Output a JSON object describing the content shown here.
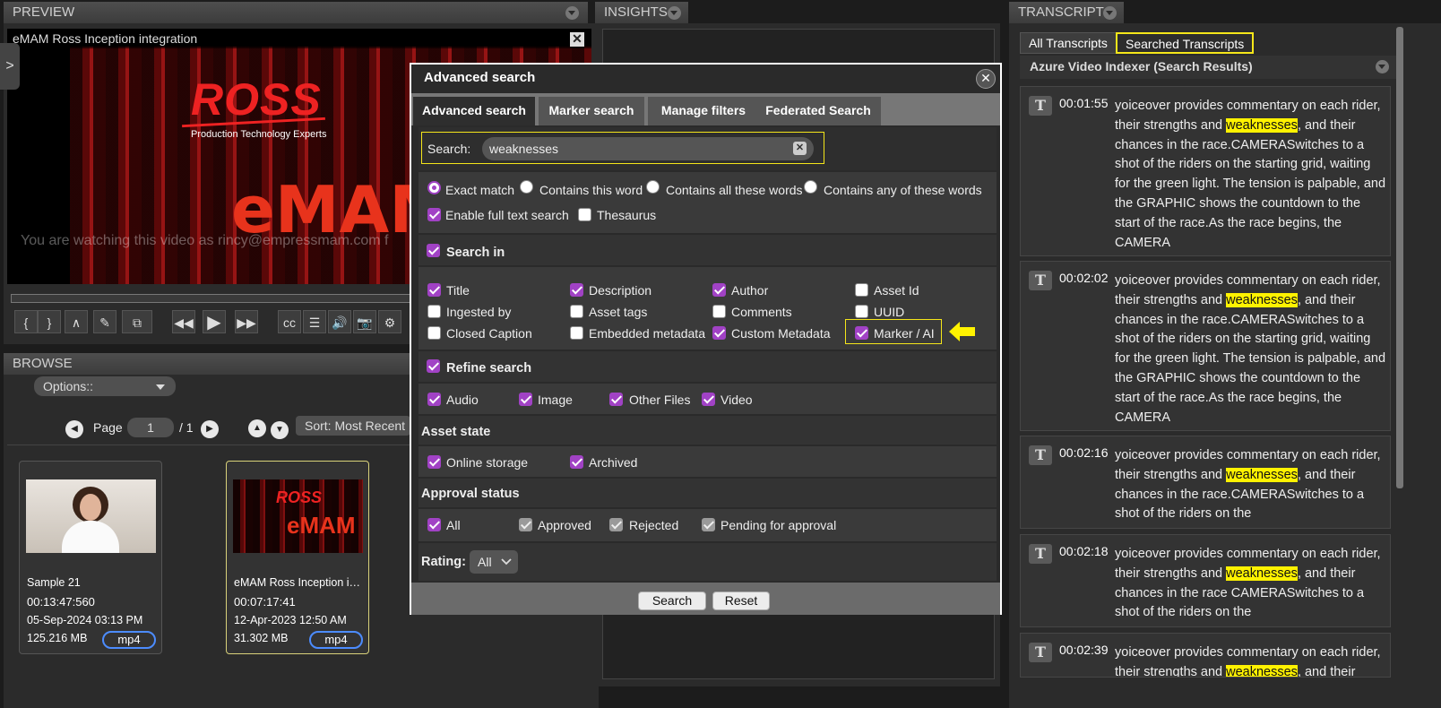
{
  "preview": {
    "header": "PREVIEW",
    "video_title": "eMAM Ross Inception integration",
    "close": "✕",
    "watermark": "You are watching this video as rincy@empressmam.com f",
    "logo_ross": "ROSS",
    "logo_ross_sub": "Production Technology Experts",
    "logo_emam": "eMAM",
    "side_tab": ">"
  },
  "controls": [
    {
      "glyph": "{"
    },
    {
      "glyph": "}"
    },
    {
      "glyph": "∧"
    },
    {
      "glyph": "✎"
    },
    {
      "glyph": "⧉"
    },
    {
      "glyph": "◀◀"
    },
    {
      "glyph": "▶"
    },
    {
      "glyph": "▶▶"
    },
    {
      "glyph": "cc"
    },
    {
      "glyph": "☰"
    },
    {
      "glyph": "🔊"
    },
    {
      "glyph": "📷"
    },
    {
      "glyph": "⚙"
    }
  ],
  "browse": {
    "header": "BROWSE",
    "options_label": "Options::",
    "page_label": "Page",
    "page_value": "1",
    "page_total": "/ 1",
    "sort_label": "Sort: Most Recent",
    "assets": [
      {
        "name": "Sample 21",
        "duration": "00:13:47:560",
        "date": "05-Sep-2024 03:13 PM",
        "size": "125.216 MB",
        "format": "mp4"
      },
      {
        "name": "eMAM Ross Inception in...",
        "duration": "00:07:17:41",
        "date": "12-Apr-2023 12:50 AM",
        "size": "31.302 MB",
        "format": "mp4"
      }
    ]
  },
  "insights": {
    "header": "INSIGHTS"
  },
  "transcript": {
    "header": "TRANSCRIPT",
    "tab_all": "All Transcripts",
    "tab_searched": "Searched Transcripts",
    "section_title": "Azure Video Indexer (Search Results)",
    "results": [
      {
        "time": "00:01:55",
        "pre": "yoiceover provides commentary on each rider, their strengths and ",
        "hit": "weaknesses",
        "post": ", and their chances in the race.CAMERASwitches to a shot of the riders on the starting grid, waiting for the green light. The tension is palpable, and the GRAPHIC shows the countdown to the start of the race.As the race begins, the CAMERA"
      },
      {
        "time": "00:02:02",
        "pre": "yoiceover provides commentary on each rider, their strengths and ",
        "hit": "weaknesses",
        "post": ", and their chances in the race.CAMERASwitches to a shot of the riders on the starting grid, waiting for the green light. The tension is palpable, and the GRAPHIC shows the countdown to the start of the race.As the race begins, the CAMERA"
      },
      {
        "time": "00:02:16",
        "pre": "yoiceover provides commentary on each rider, their strengths and ",
        "hit": "weaknesses",
        "post": ", and their chances in the race.CAMERASwitches to a shot of the riders on the"
      },
      {
        "time": "00:02:18",
        "pre": "yoiceover provides commentary on each rider, their strengths and ",
        "hit": "weaknesses",
        "post": ", and their chances in the race CAMERASwitches to a shot of the riders on the"
      },
      {
        "time": "00:02:39",
        "pre": "yoiceover provides commentary on each rider, their strengths and ",
        "hit": "weaknesses",
        "post": ", and their"
      }
    ]
  },
  "modal": {
    "title": "Advanced search",
    "close": "✕",
    "tabs": [
      "Advanced search",
      "Marker search",
      "Manage filters",
      "Federated Search"
    ],
    "search_label": "Search:",
    "search_value": "weaknesses",
    "search_clear": "✕",
    "match_options": [
      "Exact match",
      "Contains this word",
      "Contains all these words",
      "Contains any of these words"
    ],
    "full_text_label": "Enable full text search",
    "thesaurus_label": "Thesaurus",
    "search_in_label": "Search in",
    "fields": [
      "Title",
      "Description",
      "Author",
      "Asset Id",
      "Ingested by",
      "Asset tags",
      "Comments",
      "UUID",
      "Closed Caption",
      "Embedded metadata",
      "Custom Metadata",
      "Marker / AI"
    ],
    "refine_label": "Refine search",
    "refine": [
      "Audio",
      "Image",
      "Other Files",
      "Video"
    ],
    "asset_state_label": "Asset state",
    "asset_state": [
      "Online storage",
      "Archived"
    ],
    "approval_label": "Approval status",
    "approval": [
      "All",
      "Approved",
      "Rejected",
      "Pending for approval"
    ],
    "rating_label": "Rating:",
    "rating_value": "All",
    "search_button": "Search",
    "reset_button": "Reset"
  },
  "colors": {
    "accent": "#a142c5",
    "highlight": "#fff200",
    "callout": "#f5e61a"
  }
}
